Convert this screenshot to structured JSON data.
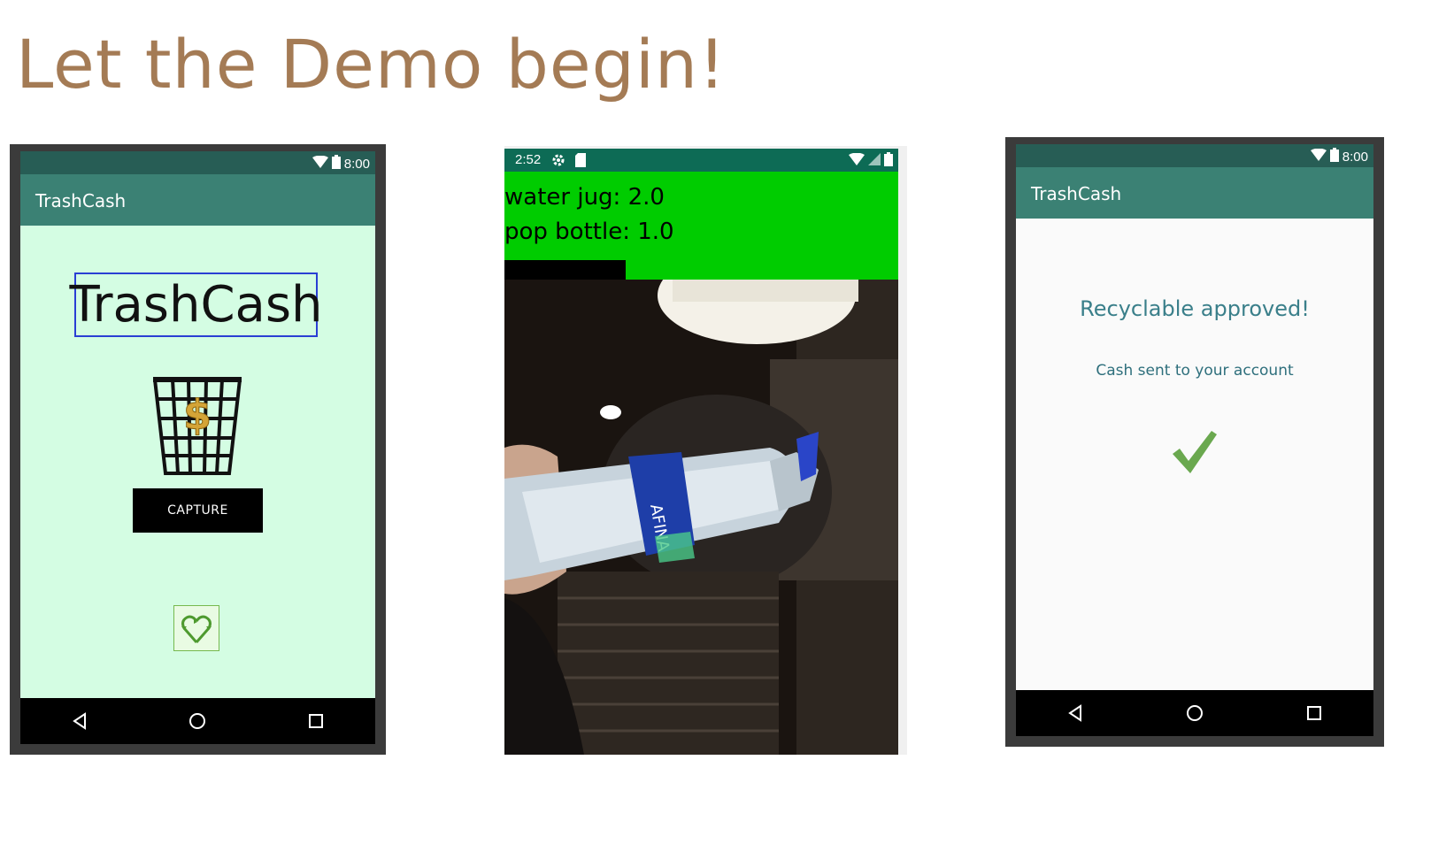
{
  "slide": {
    "title": "Let the Demo begin!"
  },
  "colors": {
    "title": "#a47b55",
    "appbar": "#3b8174",
    "statusbar": "#275d55",
    "home_bg": "#d4fde3",
    "prediction_bg": "#00cc00",
    "approved_text": "#3a7f8a",
    "check": "#6aa84f"
  },
  "phone1": {
    "status_time": "8:00",
    "app_title": "TrashCash",
    "brand_text": "TrashCash",
    "capture_label": "CAPTURE",
    "icons": [
      "wifi-icon",
      "battery-icon",
      "trash-bin-dollar-icon",
      "recycle-heart-icon",
      "back-icon",
      "home-icon",
      "recents-icon"
    ]
  },
  "phone2": {
    "status_time": "2:52",
    "predictions": [
      "water jug: 2.0",
      "pop bottle: 1.0"
    ],
    "icons": [
      "settings-icon",
      "sd-card-icon",
      "wifi-icon",
      "signal-icon",
      "battery-icon"
    ]
  },
  "phone3": {
    "status_time": "8:00",
    "app_title": "TrashCash",
    "approved_text": "Recyclable approved!",
    "cash_text": "Cash sent to your account",
    "icons": [
      "wifi-icon",
      "battery-icon",
      "checkmark-icon",
      "back-icon",
      "home-icon",
      "recents-icon"
    ]
  }
}
